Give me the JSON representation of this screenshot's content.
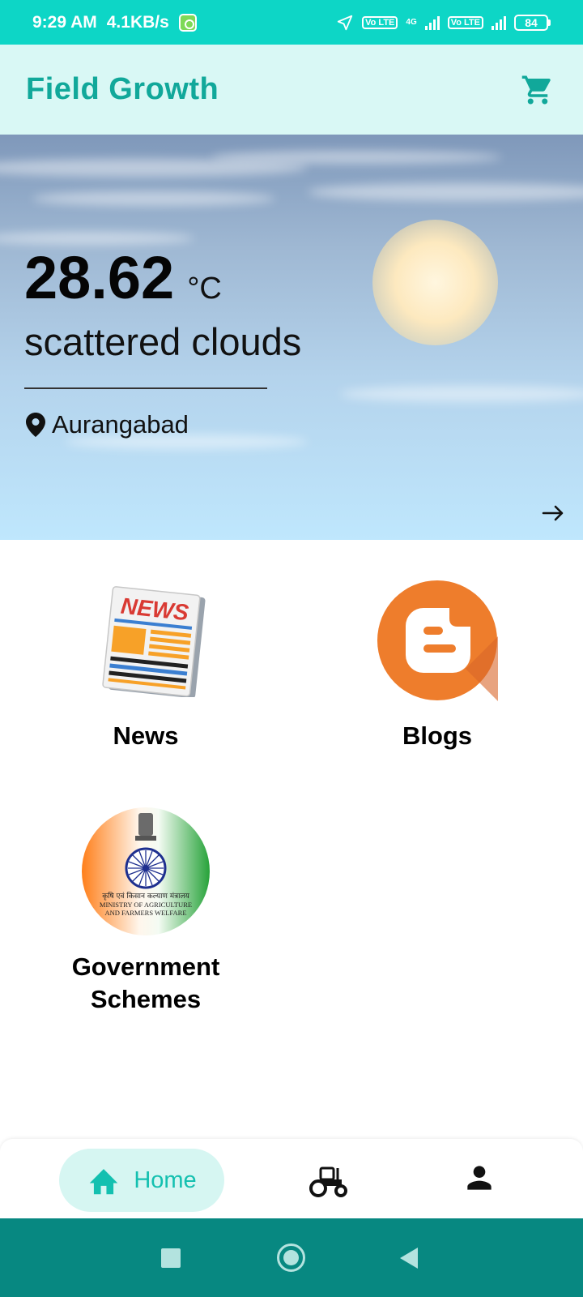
{
  "status_bar": {
    "time": "9:29 AM",
    "speed": "4.1KB/s",
    "network_4g": "4G",
    "volte_1": "Vo LTE",
    "volte_2": "Vo LTE",
    "battery": "84"
  },
  "app_bar": {
    "title": "Field Growth",
    "cart_icon": "cart-icon"
  },
  "weather": {
    "temperature": "28.62",
    "unit": "°C",
    "condition": "scattered clouds",
    "location": "Aurangabad"
  },
  "tiles": [
    {
      "label": "News",
      "icon": "newspaper-icon",
      "image_text": "NEWS"
    },
    {
      "label": "Blogs",
      "icon": "blogger-icon"
    },
    {
      "label": "Government Schemes",
      "icon": "ministry-emblem-icon",
      "image_text_1": "कृषि एवं किसान कल्याण मंत्रालय",
      "image_text_2": "MINISTRY OF AGRICULTURE",
      "image_text_3": "AND FARMERS WELFARE"
    }
  ],
  "bottom_nav": {
    "home_label": "Home",
    "items": [
      "home-icon",
      "tractor-icon",
      "profile-icon"
    ]
  },
  "colors": {
    "status_bar": "#0dd6c6",
    "app_bar": "#d9f8f5",
    "accent": "#11a89a",
    "system_nav": "#078881"
  }
}
